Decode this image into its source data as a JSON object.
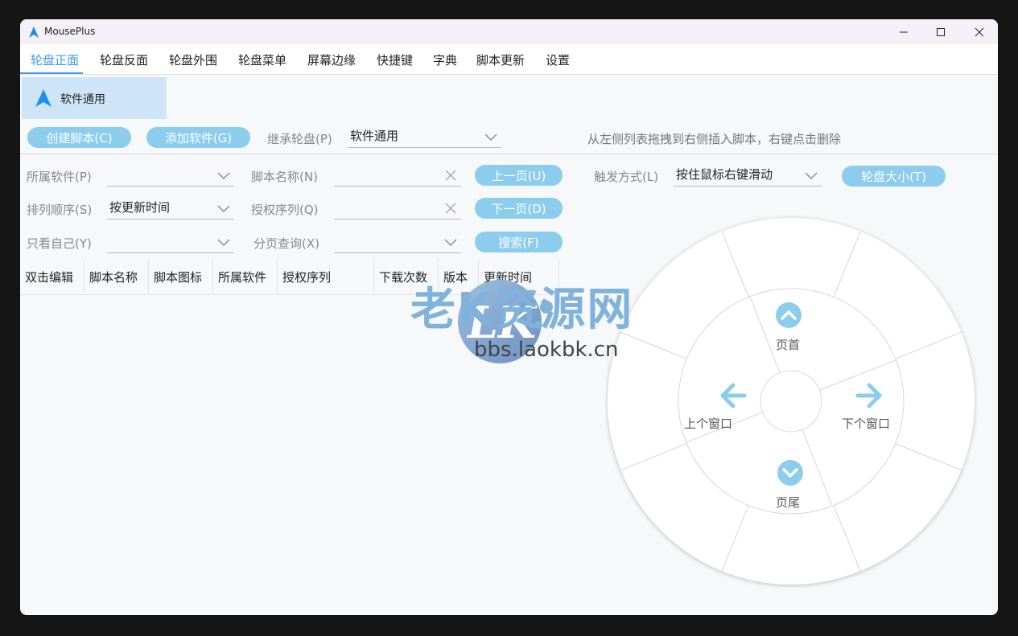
{
  "window": {
    "title": "MousePlus",
    "controls": {
      "minimize": "—",
      "maximize": "☐",
      "close": "✕"
    }
  },
  "menu": {
    "items": [
      "轮盘正面",
      "轮盘反面",
      "轮盘外围",
      "轮盘菜单",
      "屏幕边缘",
      "快捷键",
      "字典",
      "脚本更新",
      "设置"
    ],
    "active_index": 0
  },
  "software_list": {
    "selected": "软件通用"
  },
  "toolbar": {
    "create_script": "创建脚本(C)",
    "add_software": "添加软件(G)",
    "inherit_label": "继承轮盘(P)",
    "inherit_value": "软件通用",
    "hint": "从左侧列表拖拽到右侧插入脚本，右键点击删除"
  },
  "filters": {
    "software_label": "所属软件(P)",
    "software_value": "",
    "script_name_label": "脚本名称(N)",
    "script_name_value": "",
    "prev_page": "上一页(U)",
    "sort_label": "排列顺序(S)",
    "sort_value": "按更新时间",
    "license_label": "授权序列(Q)",
    "license_value": "",
    "next_page": "下一页(D)",
    "mine_label": "只看自己(Y)",
    "mine_value": "",
    "page_query_label": "分页查询(X)",
    "page_query_value": "",
    "search": "搜索(F)",
    "trigger_label": "触发方式(L)",
    "trigger_value": "按住鼠标右键滑动",
    "wheel_size": "轮盘大小(T)"
  },
  "table": {
    "columns": [
      "双击编辑",
      "脚本名称",
      "脚本图标",
      "所属软件",
      "授权序列",
      "下载次数",
      "版本",
      "更新时间"
    ]
  },
  "wheel": {
    "top": "页首",
    "left": "上个窗口",
    "right": "下个窗口",
    "bottom": "页尾"
  },
  "watermark": {
    "logo_text": "老K资源网",
    "url": "bbs.laokbk.cn"
  },
  "colors": {
    "accent": "#3c9be1",
    "pill": "#8ccdee",
    "wheel_icon": "#8ccdee"
  }
}
